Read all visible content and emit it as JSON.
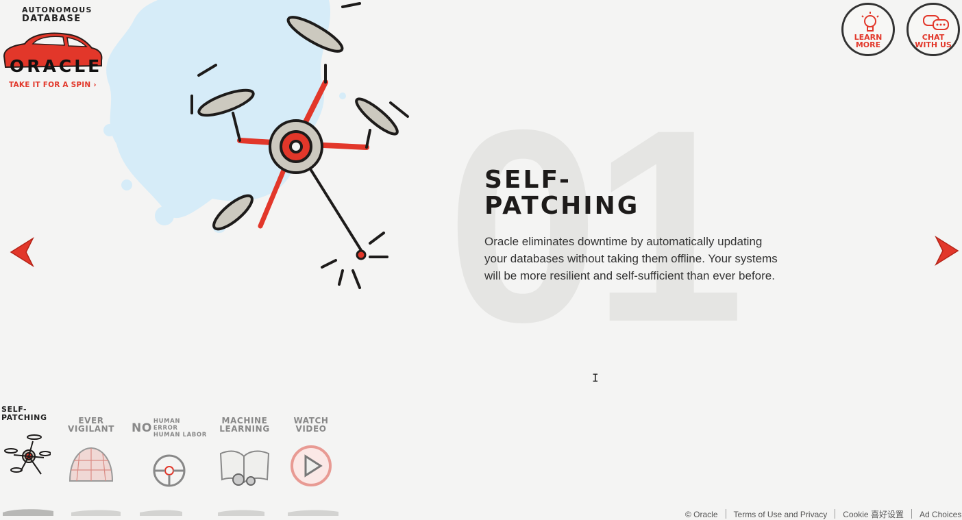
{
  "header": {
    "logo_top_line1": "AUTONOMOUS",
    "logo_top_line2": "DATABASE",
    "logo_brand": "ORACLE",
    "logo_link": "TAKE IT FOR A SPIN ›"
  },
  "badges": {
    "learn": {
      "line1": "LEARN",
      "line2": "MORE",
      "icon": "lightbulb-icon"
    },
    "chat": {
      "line1": "CHAT",
      "line2": "WITH US",
      "icon": "chat-bubbles-icon"
    }
  },
  "slide": {
    "number": "01",
    "title_line1": "SELF-",
    "title_line2": "PATCHING",
    "description": "Oracle eliminates downtime by automatically updating your databases without taking them offline. Your systems will be more resilient and self-sufficient than ever before."
  },
  "nav": {
    "items": [
      {
        "line1": "SELF-",
        "line2": "PATCHING",
        "icon": "drone-icon"
      },
      {
        "line1": "EVER",
        "line2": "VIGILANT",
        "icon": "globe-shield-icon"
      },
      {
        "line1": "NO",
        "line2a": "HUMAN ERROR",
        "line2b": "HUMAN LABOR",
        "icon": "steering-wheel-icon"
      },
      {
        "line1": "MACHINE",
        "line2": "LEARNING",
        "icon": "book-gears-icon"
      },
      {
        "line1": "WATCH",
        "line2": "VIDEO",
        "icon": "play-icon"
      }
    ]
  },
  "footer": {
    "copyright": "© Oracle",
    "terms": "Terms of Use and Privacy",
    "cookie": "Cookie 喜好设置",
    "ad": "Ad Choices"
  },
  "colors": {
    "accent": "#e2372a",
    "background": "#f4f4f3",
    "splash": "#d6ecf8"
  }
}
